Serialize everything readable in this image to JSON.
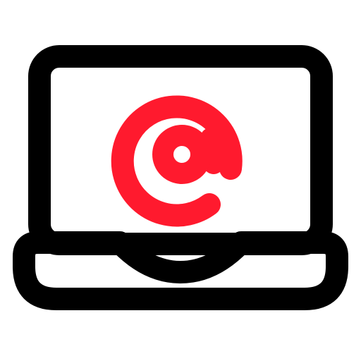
{
  "icon": {
    "name": "laptop-email-icon",
    "parts": [
      "laptop-icon",
      "at-sign-icon"
    ]
  },
  "colors": {
    "background": "#ffffff",
    "outline": "#000000",
    "accent": "#ff1a2e"
  }
}
